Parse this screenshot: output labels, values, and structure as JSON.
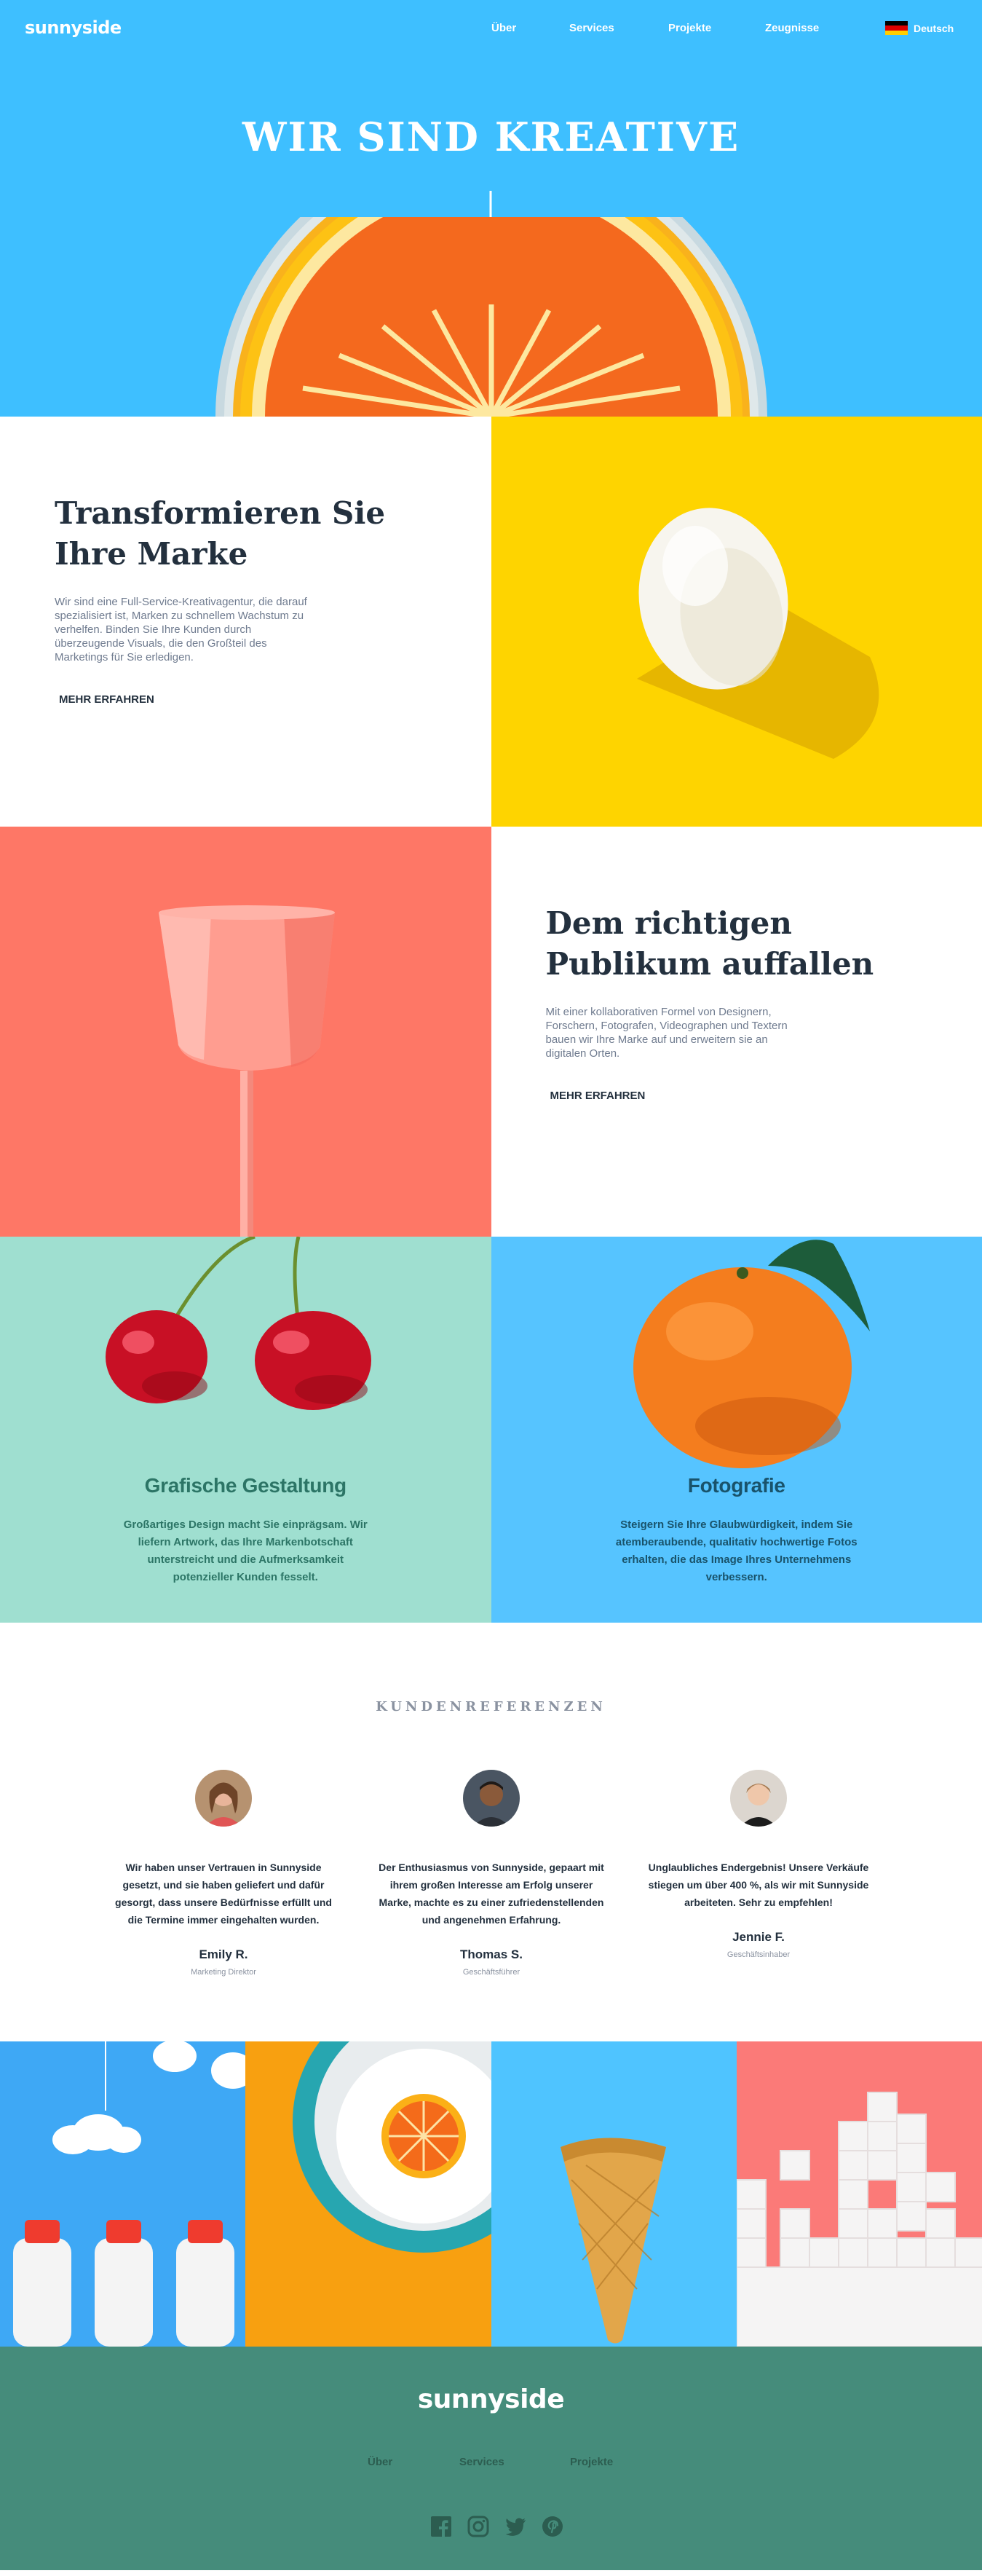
{
  "nav": {
    "logo": "sunnyside",
    "links": [
      "Über",
      "Services",
      "Projekte",
      "Zeugnisse"
    ],
    "language": "Deutsch",
    "flag_icon": "germany-flag-icon"
  },
  "hero": {
    "title": "WIR SIND KREATIVE",
    "arrow_icon": "arrow-down-icon"
  },
  "section_transform": {
    "heading": "Transformieren Sie Ihre Marke",
    "body": "Wir sind eine Full-Service-Kreativagentur, die darauf spezialisiert ist, Marken zu schnellem Wachstum zu verhelfen. Binden Sie Ihre Kunden durch überzeugende Visuals, die den Großteil des Marketings für Sie erledigen.",
    "link": "MEHR ERFAHREN"
  },
  "section_audience": {
    "heading": "Dem richtigen Publikum auffallen",
    "body": "Mit einer kollaborativen Formel von Designern, Forschern, Fotografen, Videographen und Textern bauen wir Ihre Marke auf und erweitern sie an digitalen Orten.",
    "link": "MEHR ERFAHREN"
  },
  "features": [
    {
      "title": "Grafische Gestaltung",
      "body": "Großartiges Design macht Sie einprägsam. Wir liefern Artwork, das Ihre Markenbotschaft unterstreicht und die Aufmerksamkeit potenzieller Kunden fesselt.",
      "color": "#2c7566"
    },
    {
      "title": "Fotografie",
      "body": "Steigern Sie Ihre Glaubwürdigkeit, indem Sie atemberaubende, qualitativ hochwertige Fotos erhalten, die das Image Ihres Unternehmens verbessern.",
      "color": "#19536b"
    }
  ],
  "testimonials": {
    "heading": "KUNDENREFERENZEN",
    "items": [
      {
        "quote": "Wir haben unser Vertrauen in Sunnyside gesetzt, und sie haben geliefert und dafür gesorgt, dass unsere Bedürfnisse erfüllt und die Termine immer eingehalten wurden.",
        "name": "Emily R.",
        "role": "Marketing Direktor"
      },
      {
        "quote": "Der Enthusiasmus von Sunnyside, gepaart mit ihrem großen Interesse am Erfolg unserer Marke, machte es zu einer zufriedenstellenden und angenehmen Erfahrung.",
        "name": "Thomas S.",
        "role": "Geschäftsführer"
      },
      {
        "quote": "Unglaubliches Endergebnis! Unsere Verkäufe stiegen um über 400 %, als wir mit Sunnyside arbeiteten. Sehr zu empfehlen!",
        "name": "Jennie F.",
        "role": "Geschäftsinhaber"
      }
    ]
  },
  "footer": {
    "logo": "sunnyside",
    "links": [
      "Über",
      "Services",
      "Projekte"
    ],
    "social_icons": [
      "facebook-icon",
      "instagram-icon",
      "twitter-icon",
      "pinterest-icon"
    ]
  },
  "colors": {
    "hero_blue": "#3ebfff",
    "yellow": "#fed400",
    "salmon": "#fe7766",
    "mint": "#9fdfd0",
    "sky": "#56c4ff",
    "footer_green": "#458c7b",
    "dark_text": "#23303e",
    "grey_text": "#6f7b8f"
  }
}
